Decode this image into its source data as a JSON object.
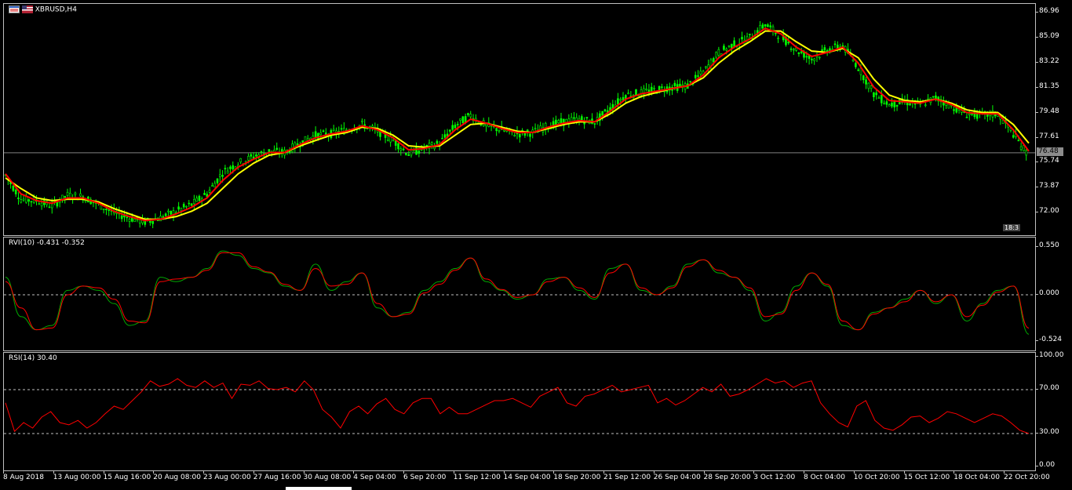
{
  "window": {
    "symbol_title": "XBRUSD,H4",
    "icons": [
      "window-icon",
      "flag-icon"
    ]
  },
  "colors": {
    "background": "#000000",
    "bull_candle": "#00ff00",
    "bear_candle": "#00ff00",
    "fast_ma": "#ff0000",
    "slow_ma": "#ffff00",
    "rvi_main": "#00aa00",
    "rvi_signal": "#ff0000",
    "rsi": "#ff0000",
    "grid_dashed": "#c0c0c0",
    "price_line": "#808080"
  },
  "current_price_label": "76.48",
  "corner_label": "18:3",
  "chart_data": [
    {
      "type": "candlestick",
      "title": "XBRUSD,H4",
      "y_ticks": [
        "86.96",
        "85.09",
        "83.22",
        "81.35",
        "79.48",
        "77.61",
        "75.74",
        "73.87",
        "72.00"
      ],
      "ylim": [
        70.6,
        87.4
      ],
      "current_price": 76.48,
      "series": [
        {
          "name": "close",
          "values": [
            74.8,
            73.0,
            72.9,
            72.5,
            73.3,
            73.2,
            72.6,
            72.0,
            71.6,
            71.3,
            71.6,
            72.1,
            72.6,
            73.4,
            75.0,
            75.7,
            76.2,
            76.6,
            76.5,
            77.2,
            77.8,
            77.9,
            78.2,
            78.6,
            78.1,
            77.4,
            76.4,
            76.8,
            77.2,
            78.5,
            79.3,
            78.5,
            78.2,
            77.9,
            78.0,
            78.5,
            78.8,
            79.0,
            78.8,
            79.8,
            80.8,
            81.0,
            81.2,
            81.4,
            81.5,
            82.5,
            84.0,
            84.6,
            85.1,
            86.1,
            85.2,
            84.2,
            83.5,
            84.2,
            84.5,
            82.9,
            80.9,
            80.1,
            80.3,
            80.1,
            80.6,
            80.0,
            79.4,
            79.3,
            79.4,
            77.9,
            76.2
          ]
        },
        {
          "name": "fast_ma",
          "values": [
            74.9,
            73.4,
            72.9,
            72.7,
            73.1,
            73.1,
            72.7,
            72.1,
            71.7,
            71.4,
            71.5,
            71.9,
            72.4,
            73.1,
            74.4,
            75.4,
            76.0,
            76.5,
            76.5,
            77.1,
            77.6,
            77.9,
            78.1,
            78.5,
            78.2,
            77.6,
            76.7,
            76.8,
            77.1,
            78.2,
            79.0,
            78.7,
            78.3,
            78.0,
            78.0,
            78.4,
            78.7,
            78.9,
            78.8,
            79.6,
            80.5,
            80.9,
            81.1,
            81.3,
            81.5,
            82.3,
            83.6,
            84.4,
            85.0,
            85.8,
            85.4,
            84.4,
            83.7,
            84.0,
            84.4,
            83.2,
            81.4,
            80.4,
            80.3,
            80.2,
            80.5,
            80.1,
            79.5,
            79.4,
            79.4,
            78.2,
            76.6
          ]
        },
        {
          "name": "slow_ma",
          "values": [
            74.6,
            73.8,
            73.1,
            72.9,
            73.0,
            73.0,
            72.8,
            72.3,
            71.9,
            71.5,
            71.5,
            71.7,
            72.1,
            72.7,
            73.8,
            74.9,
            75.7,
            76.3,
            76.5,
            77.0,
            77.4,
            77.8,
            78.0,
            78.4,
            78.3,
            77.8,
            77.0,
            76.9,
            77.0,
            77.8,
            78.6,
            78.7,
            78.4,
            78.1,
            78.0,
            78.3,
            78.6,
            78.8,
            78.8,
            79.4,
            80.2,
            80.7,
            81.0,
            81.3,
            81.5,
            82.1,
            83.2,
            84.1,
            84.8,
            85.6,
            85.6,
            84.8,
            84.1,
            84.0,
            84.3,
            83.6,
            82.0,
            80.8,
            80.4,
            80.3,
            80.5,
            80.2,
            79.7,
            79.5,
            79.5,
            78.6,
            77.2
          ]
        }
      ]
    },
    {
      "type": "line",
      "title": "RVI(10) -0.431 -0.352",
      "y_ticks": [
        "0.550",
        "0.000",
        "-0.524"
      ],
      "ylim": [
        -0.6,
        0.6
      ],
      "series": [
        {
          "name": "main",
          "values": [
            0.2,
            -0.25,
            -0.4,
            -0.35,
            0.05,
            0.1,
            0.05,
            -0.1,
            -0.35,
            -0.3,
            0.2,
            0.15,
            0.2,
            0.3,
            0.5,
            0.45,
            0.3,
            0.25,
            0.1,
            0.05,
            0.35,
            0.05,
            0.15,
            0.25,
            -0.15,
            -0.25,
            -0.2,
            0.05,
            0.15,
            0.3,
            0.42,
            0.15,
            0.05,
            -0.05,
            0.0,
            0.18,
            0.2,
            0.05,
            -0.05,
            0.3,
            0.35,
            0.05,
            0.0,
            0.1,
            0.35,
            0.4,
            0.25,
            0.2,
            0.05,
            -0.3,
            -0.2,
            0.1,
            0.25,
            0.1,
            -0.35,
            -0.4,
            -0.2,
            -0.15,
            -0.05,
            0.05,
            -0.1,
            0.0,
            -0.3,
            -0.1,
            0.05,
            0.1,
            -0.45
          ]
        },
        {
          "name": "signal",
          "values": [
            0.15,
            -0.15,
            -0.4,
            -0.38,
            0.0,
            0.1,
            0.08,
            -0.05,
            -0.3,
            -0.32,
            0.15,
            0.18,
            0.2,
            0.28,
            0.48,
            0.48,
            0.32,
            0.26,
            0.12,
            0.05,
            0.3,
            0.1,
            0.12,
            0.25,
            -0.1,
            -0.25,
            -0.22,
            0.02,
            0.12,
            0.28,
            0.42,
            0.18,
            0.06,
            -0.03,
            0.0,
            0.15,
            0.2,
            0.08,
            -0.03,
            0.25,
            0.35,
            0.08,
            0.0,
            0.08,
            0.32,
            0.4,
            0.28,
            0.2,
            0.08,
            -0.25,
            -0.22,
            0.05,
            0.25,
            0.12,
            -0.3,
            -0.4,
            -0.22,
            -0.15,
            -0.08,
            0.05,
            -0.08,
            0.0,
            -0.25,
            -0.12,
            0.03,
            0.1,
            -0.38
          ]
        }
      ]
    },
    {
      "type": "line",
      "title": "RSI(14) 30.40",
      "y_ticks": [
        "100.00",
        "70.00",
        "30.00",
        "0.00"
      ],
      "levels": [
        70,
        30
      ],
      "ylim": [
        0,
        100
      ],
      "series": [
        {
          "name": "rsi",
          "values": [
            58,
            32,
            40,
            35,
            45,
            50,
            40,
            38,
            42,
            35,
            40,
            48,
            55,
            52,
            60,
            68,
            78,
            73,
            75,
            80,
            74,
            72,
            78,
            72,
            76,
            62,
            75,
            74,
            78,
            71,
            70,
            72,
            68,
            78,
            70,
            52,
            45,
            35,
            50,
            55,
            48,
            57,
            62,
            52,
            48,
            58,
            62,
            62,
            48,
            54,
            48,
            48,
            52,
            56,
            60,
            60,
            62,
            58,
            54,
            64,
            68,
            72,
            58,
            55,
            64,
            66,
            70,
            74,
            68,
            70,
            72,
            74,
            58,
            62,
            56,
            60,
            66,
            72,
            68,
            75,
            64,
            66,
            70,
            75,
            80,
            76,
            78,
            72,
            76,
            78,
            58,
            48,
            40,
            36,
            55,
            60,
            42,
            35,
            33,
            38,
            45,
            46,
            40,
            44,
            50,
            48,
            44,
            40,
            44,
            48,
            46,
            40,
            33,
            30
          ]
        }
      ]
    }
  ],
  "x_axis": {
    "ticks": [
      "8 Aug 2018",
      "13 Aug 00:00",
      "15 Aug 16:00",
      "20 Aug 08:00",
      "23 Aug 00:00",
      "27 Aug 16:00",
      "30 Aug 08:00",
      "4 Sep 04:00",
      "6 Sep 20:00",
      "11 Sep 12:00",
      "14 Sep 04:00",
      "18 Sep 20:00",
      "21 Sep 12:00",
      "26 Sep 04:00",
      "28 Sep 20:00",
      "3 Oct 12:00",
      "8 Oct 04:00",
      "10 Oct 20:00",
      "15 Oct 12:00",
      "18 Oct 04:00",
      "22 Oct 20:00"
    ]
  }
}
